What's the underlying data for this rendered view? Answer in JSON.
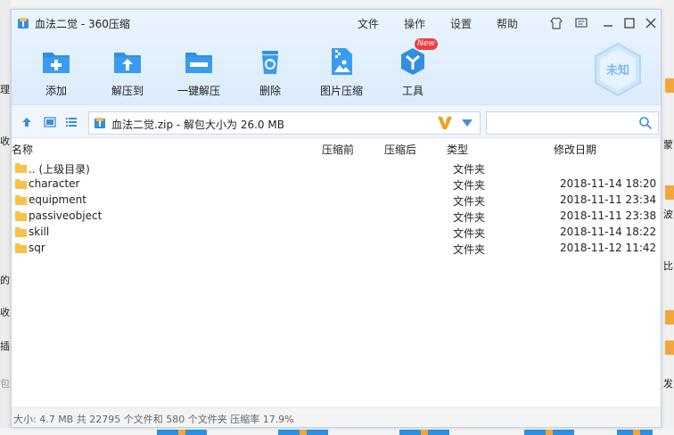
{
  "window": {
    "title": "血法二觉 - 360压缩",
    "menu": [
      "文件",
      "操作",
      "设置",
      "帮助"
    ]
  },
  "toolbar": {
    "items": [
      {
        "label": "添加",
        "icon": "add-icon"
      },
      {
        "label": "解压到",
        "icon": "extract-to-icon"
      },
      {
        "label": "一键解压",
        "icon": "one-click-extract-icon"
      },
      {
        "label": "删除",
        "icon": "delete-icon"
      },
      {
        "label": "图片压缩",
        "icon": "image-compress-icon"
      },
      {
        "label": "工具",
        "icon": "tools-icon"
      }
    ],
    "new_badge": "New",
    "status_badge": "未知"
  },
  "address": {
    "path": "血法二觉.zip - 解包大小为 26.0 MB",
    "search_placeholder": ""
  },
  "columns": {
    "name": "名称",
    "original_size": "压缩前",
    "compressed_size": "压缩后",
    "type": "类型",
    "modified": "修改日期"
  },
  "files": [
    {
      "name": ".. (上级目录)",
      "type": "文件夹",
      "date": ""
    },
    {
      "name": "character",
      "type": "文件夹",
      "date": "2018-11-14 18:20"
    },
    {
      "name": "equipment",
      "type": "文件夹",
      "date": "2018-11-11 23:34"
    },
    {
      "name": "passiveobject",
      "type": "文件夹",
      "date": "2018-11-11 23:38"
    },
    {
      "name": "skill",
      "type": "文件夹",
      "date": "2018-11-14 18:22"
    },
    {
      "name": "sqr",
      "type": "文件夹",
      "date": "2018-11-12 11:42"
    }
  ],
  "status": {
    "text": "大小: 4.7 MB 共 22795 个文件和 580 个文件夹 压缩率 17.9%"
  },
  "background": {
    "left_fragments": [
      "理",
      "收",
      "的",
      "收",
      "插",
      "包"
    ],
    "right_fragments": [
      "蒙",
      "波",
      "比",
      "发"
    ]
  },
  "colors": {
    "accent": "#2f8fe0",
    "folder": "#f6c24a",
    "header_bg": "#e4f0fd",
    "badge_red": "#f03e3e",
    "v_orange": "#f0a020"
  }
}
